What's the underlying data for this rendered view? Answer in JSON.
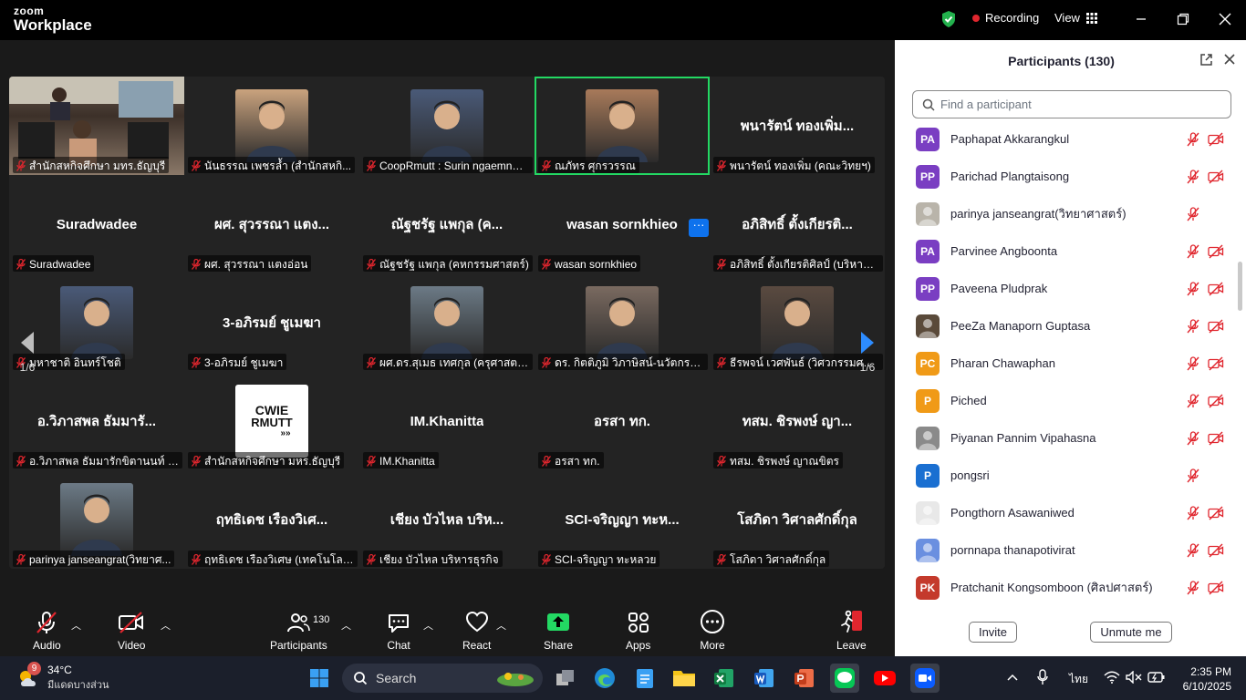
{
  "titlebar": {
    "brand_top": "zoom",
    "brand_bottom": "Workplace",
    "recording": "Recording",
    "view": "View"
  },
  "gallery": {
    "page_left": "1/6",
    "page_right": "1/6",
    "tiles": [
      {
        "label": "สำนักสหกิจศึกษา มทร.ธัญบุรี",
        "big": "",
        "type": "video"
      },
      {
        "label": "นันธรรณ เพชรล้ำ (สำนักสหกิ...",
        "big": "",
        "type": "photo"
      },
      {
        "label": "CoopRmutt : Surin ngaemngam",
        "big": "",
        "type": "photo"
      },
      {
        "label": "ณภัทร ศุกรวรรณ",
        "big": "",
        "type": "photo"
      },
      {
        "label": "พนารัตน์ ทองเพิ่ม (คณะวิทยฯ)",
        "big": "พนารัตน์ ทองเพิ่ม...",
        "type": "name"
      },
      {
        "label": "Suradwadee",
        "big": "Suradwadee",
        "type": "name"
      },
      {
        "label": "ผศ. สุวรรณา แตงอ่อน",
        "big": "ผศ. สุวรรณา แตง...",
        "type": "name"
      },
      {
        "label": "ณัฐชรัฐ แพกุล (คหกรรมศาสตร์)",
        "big": "ณัฐชรัฐ แพกุล (ค...",
        "type": "name"
      },
      {
        "label": "wasan sornkhieo",
        "big": "wasan sornkhieo",
        "type": "name"
      },
      {
        "label": "อภิสิทธิ์ ตั้งเกียรติศิลป์ (บริหารธุร...",
        "big": "อภิสิทธิ์ ตั้งเกียรติ...",
        "type": "name"
      },
      {
        "label": "มหาชาติ อินทร์โชติ",
        "big": "",
        "type": "photo"
      },
      {
        "label": "3-อภิรมย์ ชูเมฆา",
        "big": "3-อภิรมย์ ชูเมฆา",
        "type": "name"
      },
      {
        "label": "ผศ.ดร.สุเมธ เทศกุล (ครุศาสตร์อุ...",
        "big": "",
        "type": "photo"
      },
      {
        "label": "ดร. กิตติภูมิ วิภาษิสน์-นวัตกรรมฯ",
        "big": "",
        "type": "photo"
      },
      {
        "label": "ธีรพจน์ เวศพันธ์ (วิศวกรรมศาสตร์)",
        "big": "",
        "type": "photo"
      },
      {
        "label": "อ.วิภาสพล ธัมมารักขิตานนท์ - ...",
        "big": "อ.วิภาสพล ธัมมารั...",
        "type": "name"
      },
      {
        "label": "สำนักสหกิจศึกษา มหร.ธัญบุรี",
        "big": "",
        "type": "logo"
      },
      {
        "label": "IM.Khanitta",
        "big": "IM.Khanitta",
        "type": "name"
      },
      {
        "label": "อรสา ทก.",
        "big": "อรสา ทก.",
        "type": "name"
      },
      {
        "label": "ทสม. ชิรพงษ์ ญาณขิตร",
        "big": "ทสม. ชิรพงษ์ ญา...",
        "type": "name"
      },
      {
        "label": "parinya janseangrat(วิทยาศ...",
        "big": "",
        "type": "photo"
      },
      {
        "label": "ฤทธิเดช เรืองวิเศษ (เทคโนโลยีคห...",
        "big": "ฤทธิเดช เรืองวิเศ...",
        "type": "name"
      },
      {
        "label": "เชียง บัวไหล บริหารธุรกิจ",
        "big": "เชียง บัวไหล บริห...",
        "type": "name"
      },
      {
        "label": "SCI-จริญญา ทะหลวย",
        "big": "SCI-จริญญา ทะห...",
        "type": "name"
      },
      {
        "label": "โสภิดา วิศาลศักดิ์กุล",
        "big": "โสภิดา วิศาลศักดิ์กุล",
        "type": "name"
      }
    ],
    "logo_line1": "CWIE",
    "logo_line2": "RMUTT",
    "more": "···"
  },
  "toolbar": {
    "audio": "Audio",
    "video": "Video",
    "participants": "Participants",
    "participants_count": "130",
    "chat": "Chat",
    "react": "React",
    "share": "Share",
    "apps": "Apps",
    "more": "More",
    "leave": "Leave"
  },
  "panel": {
    "title": "Participants (130)",
    "search_placeholder": "Find a participant",
    "invite": "Invite",
    "unmute_me": "Unmute me",
    "participants": [
      {
        "initials": "PA",
        "name": "Paphapat Akkarangkul",
        "color": "#7a3ec2",
        "video": true
      },
      {
        "initials": "PP",
        "name": "Parichad Plangtaisong",
        "color": "#7a3ec2",
        "video": true
      },
      {
        "initials": "",
        "name": "parinya janseangrat(วิทยาศาสตร์)",
        "color": "#b9b4aa",
        "video": false
      },
      {
        "initials": "PA",
        "name": "Parvinee Angboonta",
        "color": "#7a3ec2",
        "video": true
      },
      {
        "initials": "PP",
        "name": "Paveena  Pludprak",
        "color": "#7a3ec2",
        "video": true
      },
      {
        "initials": "",
        "name": "PeeZa Manaporn Guptasa",
        "color": "#5a4a3a",
        "video": true
      },
      {
        "initials": "PC",
        "name": "Pharan Chawaphan",
        "color": "#f09a17",
        "video": true
      },
      {
        "initials": "P",
        "name": "Piched",
        "color": "#f09a17",
        "video": true
      },
      {
        "initials": "",
        "name": "Piyanan Pannim Vipahasna",
        "color": "#8a8a8a",
        "video": true
      },
      {
        "initials": "P",
        "name": "pongsri",
        "color": "#1a6fd1",
        "video": false
      },
      {
        "initials": "",
        "name": "Pongthorn Asawaniwed",
        "color": "#e8e8e8",
        "video": true
      },
      {
        "initials": "",
        "name": "pornnapa thanapotivirat",
        "color": "#6a8fe0",
        "video": true
      },
      {
        "initials": "PK",
        "name": "Pratchanit Kongsomboon (ศิลปศาสตร์)",
        "color": "#c43a2c",
        "video": true
      }
    ]
  },
  "taskbar": {
    "badge": "9",
    "temp": "34°C",
    "weather_desc": "มีแดดบางส่วน",
    "search": "Search",
    "lang": "ไทย",
    "time": "2:35 PM",
    "date": "6/10/2025"
  }
}
